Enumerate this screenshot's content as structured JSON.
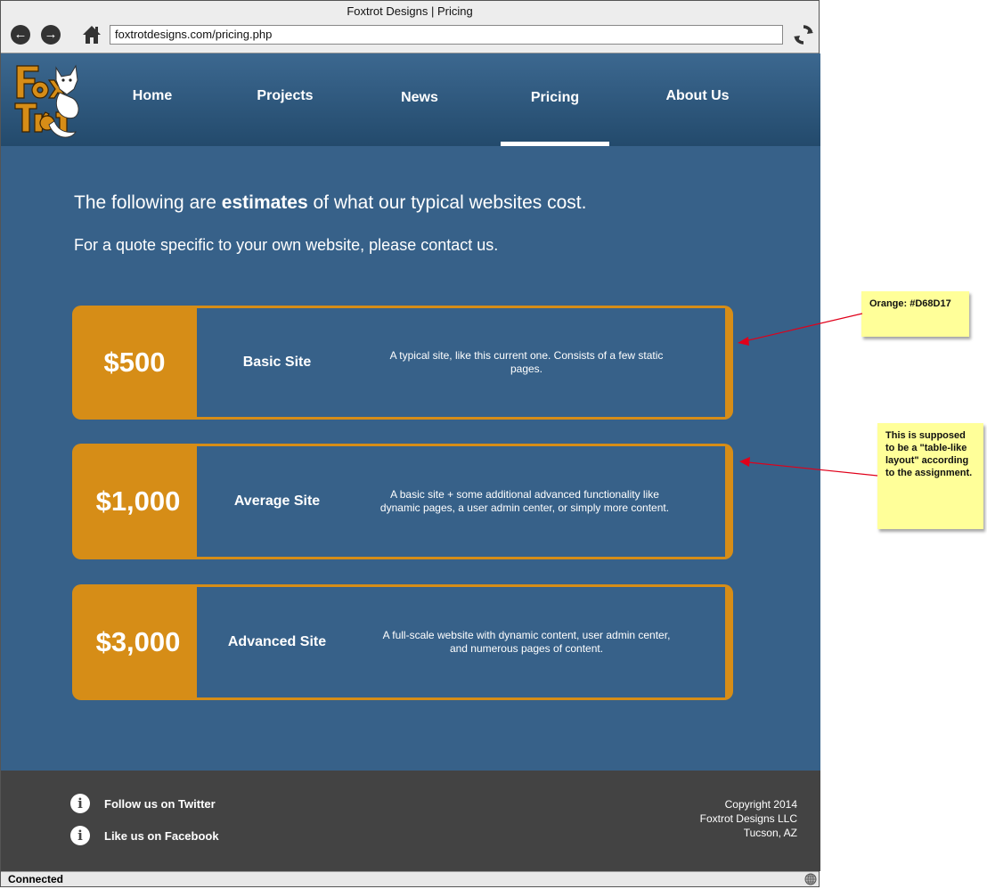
{
  "browser": {
    "title": "Foxtrot Designs | Pricing",
    "url": "foxtrotdesigns.com/pricing.php",
    "status": "Connected"
  },
  "nav": {
    "items": [
      {
        "label": "Home"
      },
      {
        "label": "Projects"
      },
      {
        "label": "News"
      },
      {
        "label": "Pricing",
        "active": true
      },
      {
        "label": "About Us"
      }
    ]
  },
  "intro": {
    "line1_before": "The following are ",
    "line1_bold": "estimates",
    "line1_after": " of what our typical websites cost.",
    "line2": "For a quote specific to your own website, please contact us."
  },
  "plans": [
    {
      "price": "$500",
      "name": "Basic Site",
      "description": "A typical site, like this current one. Consists of a few static pages."
    },
    {
      "price": "$1,000",
      "name": "Average Site",
      "description": "A basic site + some additional advanced functionality like dynamic pages, a user admin center, or simply more content."
    },
    {
      "price": "$3,000",
      "name": "Advanced Site",
      "description": "A full-scale website with dynamic content, user admin center, and numerous pages of content."
    }
  ],
  "footer": {
    "twitter": "Follow us on Twitter",
    "facebook": "Like us on Facebook",
    "copyright": [
      "Copyright 2014",
      "Foxtrot Designs LLC",
      "Tucson, AZ"
    ]
  },
  "annotations": {
    "orange_note": "Orange: #D68D17",
    "layout_note": "This is supposed to be a \"table-like layout\" according to the assignment."
  },
  "colors": {
    "accent_orange": "#D68D17",
    "site_blue": "#376189",
    "footer_gray": "#434343",
    "sticky_yellow": "#ffff99",
    "arrow_red": "#e0001a"
  },
  "icons": {
    "back": "back-arrow-icon",
    "forward": "forward-arrow-icon",
    "home": "home-icon",
    "reload": "reload-icon",
    "info": "info-icon",
    "globe": "globe-icon"
  }
}
